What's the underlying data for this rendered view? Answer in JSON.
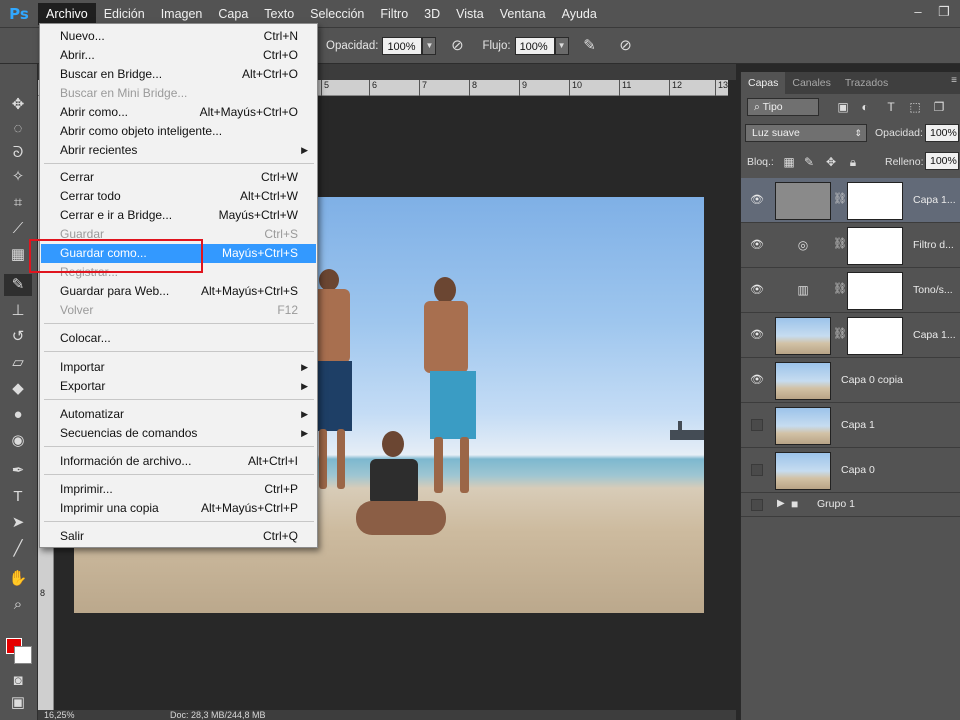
{
  "app": {
    "logo": "Ps"
  },
  "menubar": {
    "items": [
      "Archivo",
      "Edición",
      "Imagen",
      "Capa",
      "Texto",
      "Selección",
      "Filtro",
      "3D",
      "Vista",
      "Ventana",
      "Ayuda"
    ],
    "active_index": 0
  },
  "window_controls": {
    "minimize": "–",
    "restore": "❐"
  },
  "options_bar": {
    "opacity_label": "Opacidad:",
    "opacity_value": "100%",
    "flow_label": "Flujo:",
    "flow_value": "100%"
  },
  "file_menu": {
    "items": [
      {
        "label": "Nuevo...",
        "shortcut": "Ctrl+N"
      },
      {
        "label": "Abrir...",
        "shortcut": "Ctrl+O"
      },
      {
        "label": "Buscar en Bridge...",
        "shortcut": "Alt+Ctrl+O"
      },
      {
        "label": "Buscar en Mini Bridge...",
        "shortcut": "",
        "disabled": true
      },
      {
        "label": "Abrir como...",
        "shortcut": "Alt+Mayús+Ctrl+O"
      },
      {
        "label": "Abrir como objeto inteligente...",
        "shortcut": ""
      },
      {
        "label": "Abrir recientes",
        "shortcut": "",
        "submenu": true
      },
      {
        "label": "Cerrar",
        "shortcut": "Ctrl+W"
      },
      {
        "label": "Cerrar todo",
        "shortcut": "Alt+Ctrl+W"
      },
      {
        "label": "Cerrar e ir a Bridge...",
        "shortcut": "Mayús+Ctrl+W"
      },
      {
        "label": "Guardar",
        "shortcut": "Ctrl+S",
        "disabled": true
      },
      {
        "label": "Guardar como...",
        "shortcut": "Mayús+Ctrl+S",
        "highlight": true
      },
      {
        "label": "Registrar...",
        "shortcut": "",
        "disabled": true
      },
      {
        "label": "Guardar para Web...",
        "shortcut": "Alt+Mayús+Ctrl+S"
      },
      {
        "label": "Volver",
        "shortcut": "F12",
        "disabled": true
      },
      {
        "label": "Colocar...",
        "shortcut": ""
      },
      {
        "label": "Importar",
        "shortcut": "",
        "submenu": true
      },
      {
        "label": "Exportar",
        "shortcut": "",
        "submenu": true
      },
      {
        "label": "Automatizar",
        "shortcut": "",
        "submenu": true
      },
      {
        "label": "Secuencias de comandos",
        "shortcut": "",
        "submenu": true
      },
      {
        "label": "Información de archivo...",
        "shortcut": "Alt+Ctrl+I"
      },
      {
        "label": "Imprimir...",
        "shortcut": "Ctrl+P"
      },
      {
        "label": "Imprimir una copia",
        "shortcut": "Alt+Mayús+Ctrl+P"
      },
      {
        "label": "Salir",
        "shortcut": "Ctrl+Q"
      }
    ]
  },
  "ruler": {
    "top_ticks": [
      "5",
      "6",
      "7",
      "8",
      "9",
      "10",
      "11",
      "12",
      "13"
    ],
    "left_ticks": [
      "7",
      "8"
    ]
  },
  "layers_panel": {
    "tabs": [
      "Capas",
      "Canales",
      "Trazados"
    ],
    "active_tab": 0,
    "filter_value": "Tipo",
    "blend_mode": "Luz suave",
    "opacity_label": "Opacidad:",
    "opacity_value": "100%",
    "lock_label": "Bloq.:",
    "fill_label": "Relleno:",
    "fill_value": "100%",
    "layers": [
      {
        "name": "Capa 1...",
        "visible": true,
        "selected": true
      },
      {
        "name": "Filtro d...",
        "visible": true
      },
      {
        "name": "Tono/s...",
        "visible": true
      },
      {
        "name": "Capa 1...",
        "visible": true
      },
      {
        "name": "Capa 0 copia",
        "visible": true
      },
      {
        "name": "Capa 1",
        "visible": false
      },
      {
        "name": "Capa 0",
        "visible": false
      }
    ],
    "group": {
      "name": "Grupo 1"
    }
  },
  "status_bar": {
    "zoom": "16,25%",
    "doc": "Doc: 28,3 MB/244,8 MB"
  },
  "colors": {
    "foreground": "#e50000",
    "background": "#ffffff",
    "highlight": "#3399ff",
    "annotation": "#e0141e"
  },
  "icons": {
    "eye": "eye-icon",
    "chain": "link-icon",
    "folder": "folder-icon"
  }
}
